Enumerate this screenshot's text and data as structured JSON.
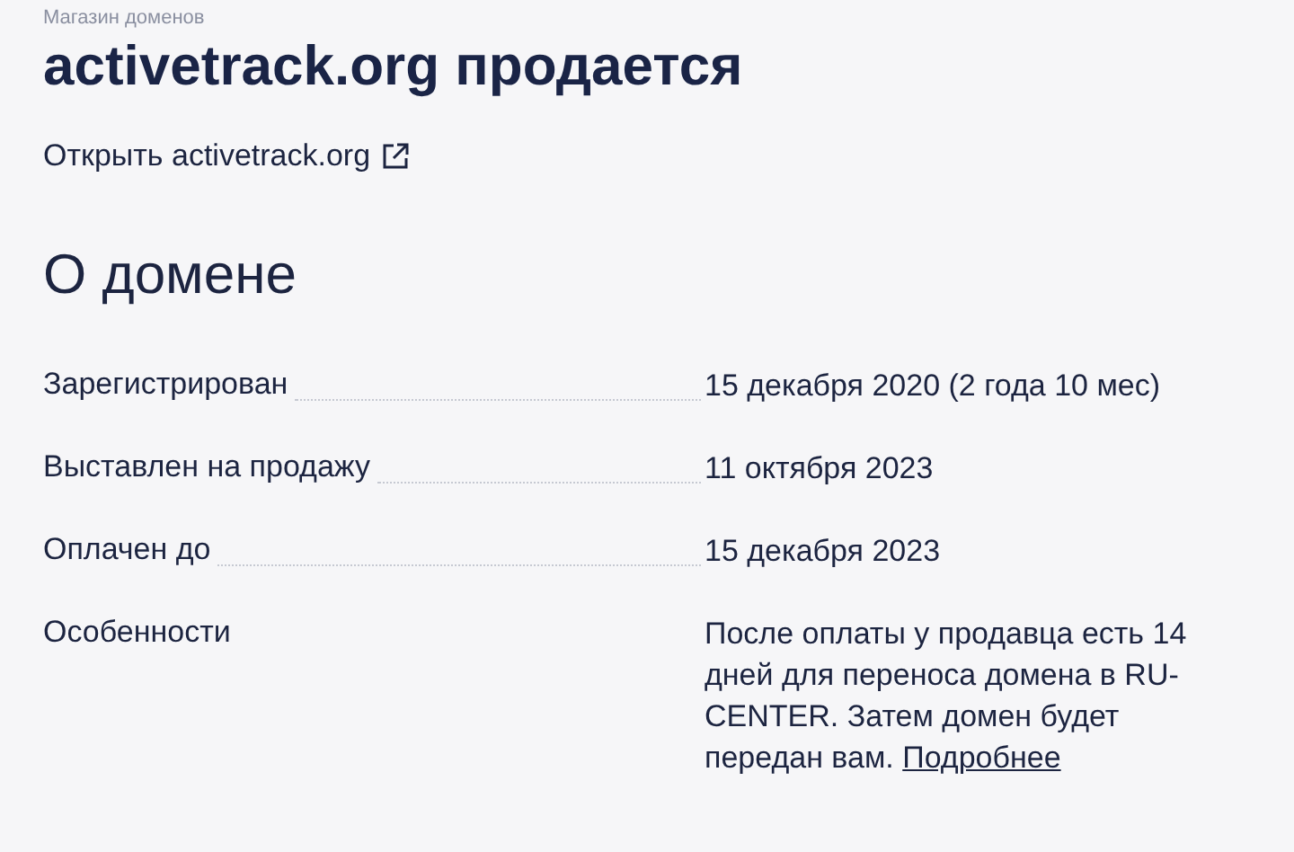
{
  "breadcrumb": "Магазин доменов",
  "title": "activetrack.org продается",
  "open_link": "Открыть activetrack.org",
  "section_title": "О домене",
  "rows": [
    {
      "label": "Зарегистрирован",
      "value": "15 декабря 2020 (2 года 10 мес)"
    },
    {
      "label": "Выставлен на продажу",
      "value": "11 октября 2023"
    },
    {
      "label": "Оплачен до",
      "value": "15 декабря 2023"
    },
    {
      "label": "Особенности",
      "value": "После оплаты у продавца есть 14 дней для переноса домена в RU-CENTER. Затем домен будет передан вам.",
      "link": "Подробнее"
    }
  ]
}
